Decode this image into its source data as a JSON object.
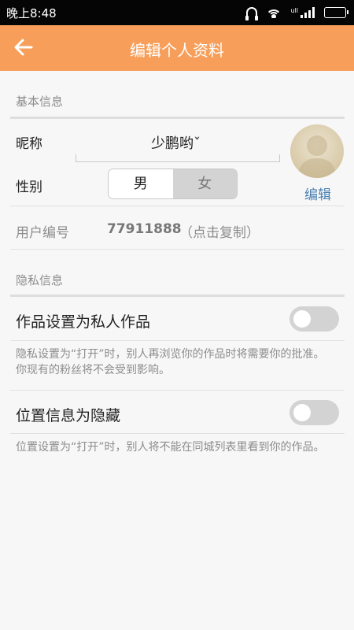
{
  "status_bar": {
    "time": "晚上8:48",
    "signal_label": "ull",
    "icons": [
      "headphones-icon",
      "wifi-icon",
      "signal-icon",
      "battery-icon"
    ]
  },
  "app_bar": {
    "title": "编辑个人资料",
    "back_icon": "arrow-left-icon",
    "background_color": "#f79f5a"
  },
  "basic_info": {
    "section_title": "基本信息",
    "nickname_label": "昵称",
    "nickname_value": "少鹏哟ˇ",
    "gender_label": "性别",
    "gender_options": [
      "男",
      "女"
    ],
    "gender_selected": "男",
    "avatar_edit_label": "编辑",
    "user_id_label": "用户编号",
    "user_id_value": "77911888",
    "user_id_hint": "（点击复制）"
  },
  "privacy": {
    "section_title": "隐私信息",
    "items": [
      {
        "label": "作品设置为私人作品",
        "enabled": false,
        "description": "隐私设置为“打开”时，别人再浏览你的作品时将需要你的批准。你现有的粉丝将不会受到影响。"
      },
      {
        "label": "位置信息为隐藏",
        "enabled": false,
        "description": "位置设置为“打开”时，别人将不能在同城列表里看到你的作品。"
      }
    ]
  }
}
